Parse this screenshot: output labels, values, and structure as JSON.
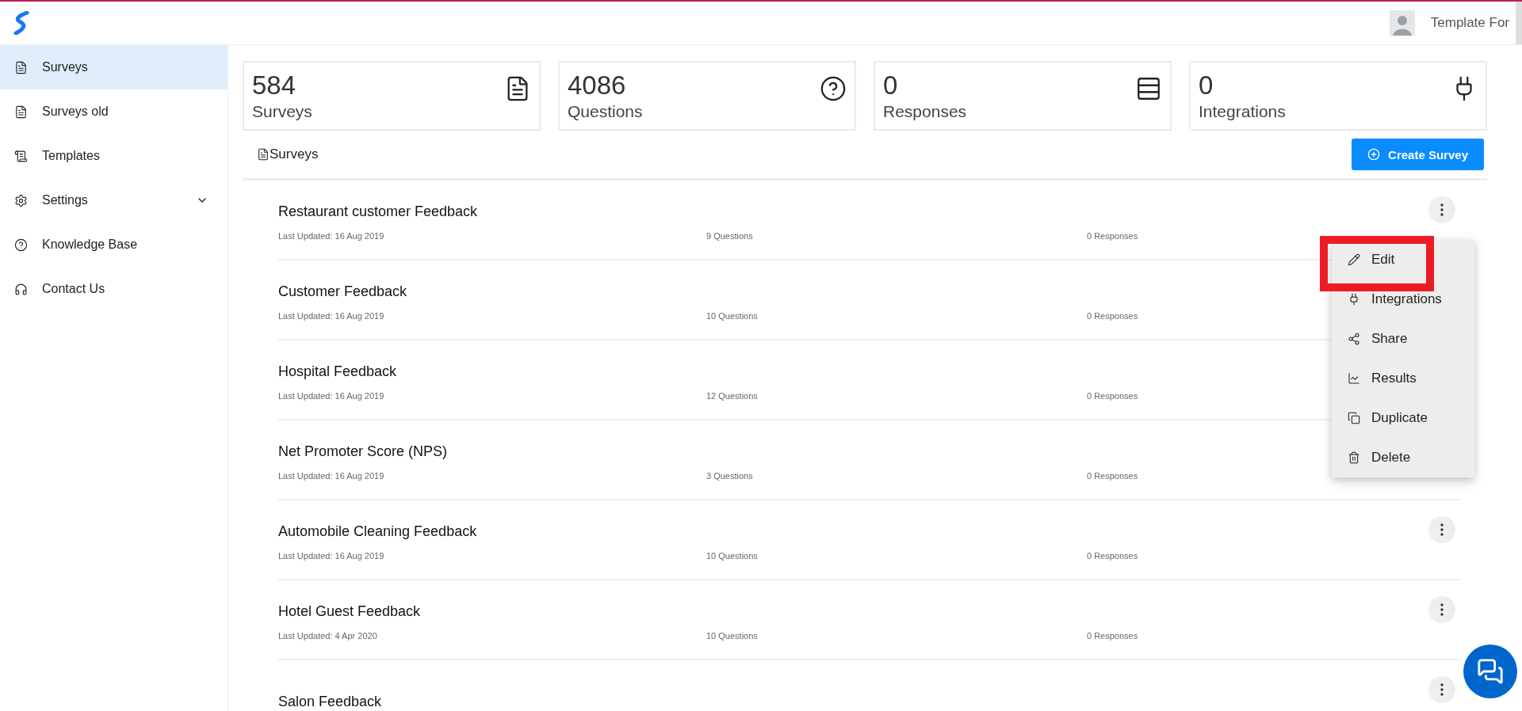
{
  "header": {
    "user_name": "Template For"
  },
  "sidebar": {
    "items": [
      {
        "label": "Surveys",
        "selected": true,
        "expandable": false
      },
      {
        "label": "Surveys old",
        "selected": false,
        "expandable": false
      },
      {
        "label": "Templates",
        "selected": false,
        "expandable": false
      },
      {
        "label": "Settings",
        "selected": false,
        "expandable": true
      },
      {
        "label": "Knowledge Base",
        "selected": false,
        "expandable": false
      },
      {
        "label": "Contact Us",
        "selected": false,
        "expandable": false
      }
    ]
  },
  "stats": [
    {
      "value": "584",
      "label": "Surveys"
    },
    {
      "value": "4086",
      "label": "Questions"
    },
    {
      "value": "0",
      "label": "Responses"
    },
    {
      "value": "0",
      "label": "Integrations"
    }
  ],
  "section": {
    "title": "Surveys",
    "button": "Create Survey"
  },
  "surveys": [
    {
      "title": "Restaurant customer Feedback",
      "updated": "Last Updated: 16 Aug 2019",
      "questions": "9 Questions",
      "responses": "0 Responses"
    },
    {
      "title": "Customer Feedback",
      "updated": "Last Updated: 16 Aug 2019",
      "questions": "10 Questions",
      "responses": "0 Responses"
    },
    {
      "title": "Hospital Feedback",
      "updated": "Last Updated: 16 Aug 2019",
      "questions": "12 Questions",
      "responses": "0 Responses"
    },
    {
      "title": "Net Promoter Score (NPS)",
      "updated": "Last Updated: 16 Aug 2019",
      "questions": "3 Questions",
      "responses": "0 Responses"
    },
    {
      "title": "Automobile Cleaning Feedback",
      "updated": "Last Updated: 16 Aug 2019",
      "questions": "10 Questions",
      "responses": "0 Responses"
    },
    {
      "title": "Hotel Guest Feedback",
      "updated": "Last Updated: 4 Apr 2020",
      "questions": "10 Questions",
      "responses": "0 Responses"
    },
    {
      "title": "Salon Feedback"
    }
  ],
  "menu": {
    "items": [
      {
        "label": "Edit",
        "highlighted": true
      },
      {
        "label": "Integrations",
        "highlighted": false
      },
      {
        "label": "Share",
        "highlighted": false
      },
      {
        "label": "Results",
        "highlighted": false
      },
      {
        "label": "Duplicate",
        "highlighted": false
      },
      {
        "label": "Delete",
        "highlighted": false
      }
    ]
  }
}
